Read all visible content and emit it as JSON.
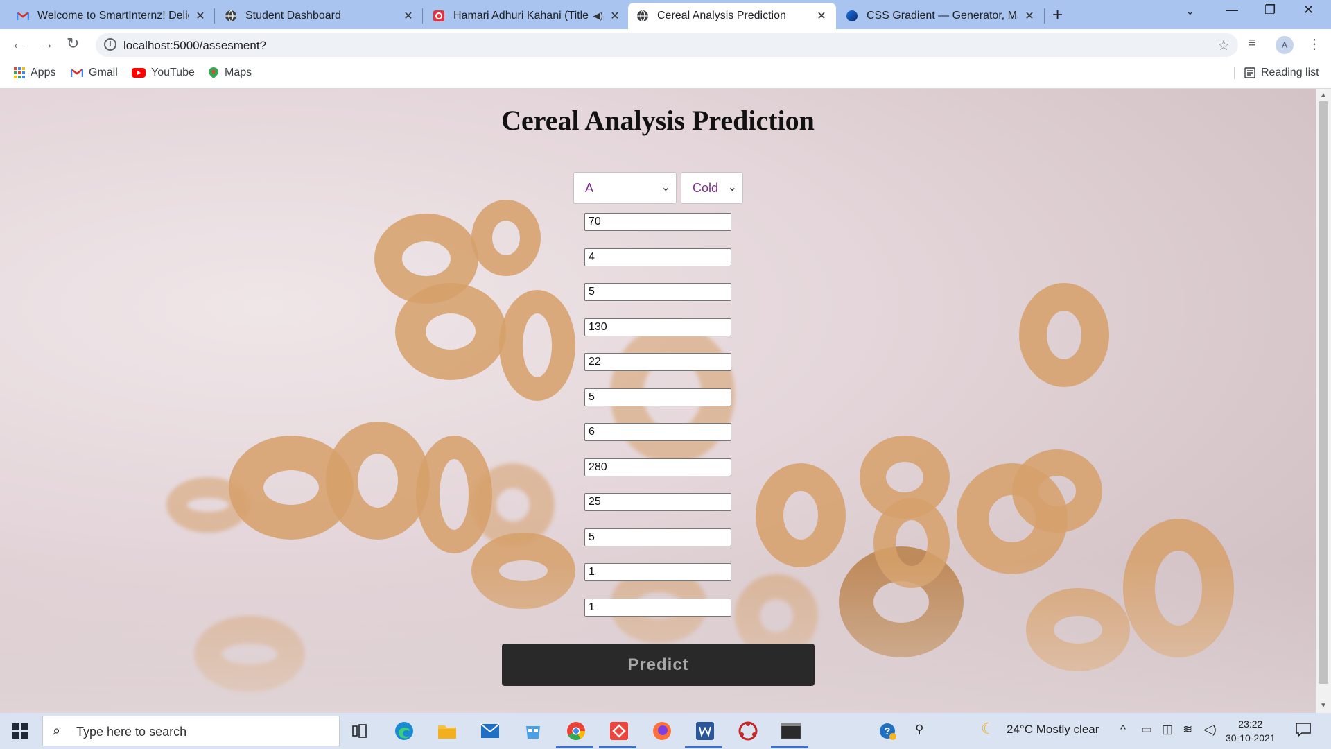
{
  "browser": {
    "tabs": [
      {
        "title": "Welcome to SmartInternz! Deligh",
        "icon": "gmail-icon",
        "active": false
      },
      {
        "title": "Student Dashboard",
        "icon": "globe-icon",
        "active": false
      },
      {
        "title": "Hamari Adhuri Kahani (Title T",
        "icon": "music-icon",
        "active": false,
        "audio": true
      },
      {
        "title": "Cereal Analysis Prediction",
        "icon": "globe-icon",
        "active": true
      },
      {
        "title": "CSS Gradient — Generator, Make",
        "icon": "gradient-icon",
        "active": false
      }
    ],
    "url": "localhost:5000/assesment?",
    "avatar_initial": "A",
    "bookmarks": [
      {
        "label": "Apps",
        "icon": "apps-grid-icon"
      },
      {
        "label": "Gmail",
        "icon": "gmail-icon"
      },
      {
        "label": "YouTube",
        "icon": "youtube-icon"
      },
      {
        "label": "Maps",
        "icon": "maps-icon"
      }
    ],
    "reading_list_label": "Reading list"
  },
  "page": {
    "title": "Cereal Analysis Prediction",
    "manufacturer_select": "A",
    "type_select": "Cold",
    "inputs": [
      "70",
      "4",
      "5",
      "130",
      "22",
      "5",
      "6",
      "280",
      "25",
      "5",
      "1",
      "1"
    ],
    "predict_label": "Predict"
  },
  "taskbar": {
    "search_placeholder": "Type here to search",
    "weather": "24°C  Mostly clear",
    "time": "23:22",
    "date": "30-10-2021"
  },
  "colors": {
    "tab_strip": "#a9c5ef",
    "select_text": "#7d2c8e",
    "predict_button": "#292929"
  }
}
